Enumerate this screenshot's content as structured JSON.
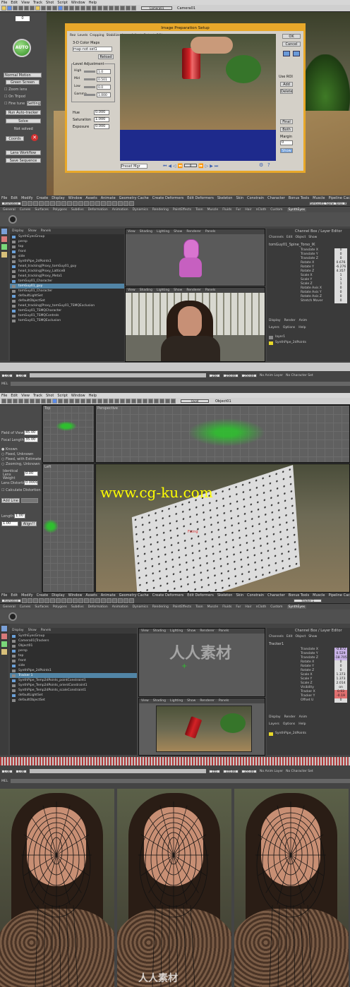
{
  "synth": {
    "menu": [
      "File",
      "Edit",
      "View",
      "Track",
      "Shot",
      "Script",
      "Window",
      "Help"
    ],
    "camera_select": "Camera01",
    "camera_label": "Camera01",
    "counter": "0",
    "auto_label": "AUTO",
    "motion_select": "Normal Motion",
    "green_screen": "Green Screen",
    "zoom_lens": "Zoom lens",
    "on_tripod": "On Tripod",
    "fine_tune": "Fine tune",
    "settings": "Settings",
    "run_auto": "Run Auto-tracker",
    "solve": "Solve",
    "not_solved": "Not solved",
    "coords": "Coords",
    "lens_workflow": "Lens Workflow",
    "save_sequence": "Save Sequence"
  },
  "dialog": {
    "title": "Image Preparation Setup",
    "tabs": [
      "Rez",
      "Levels",
      "Cropping",
      "Stabilize",
      "Lens",
      "Adjust",
      "Output",
      "ROI"
    ],
    "color_mode_label": "3-D Color Maps",
    "color_mode": "map-not-set1",
    "reload": "Reload",
    "group_title": "Level Adjustment",
    "levels": [
      {
        "label": "High",
        "value": "1.0"
      },
      {
        "label": "Mid",
        "value": "0.501"
      },
      {
        "label": "Low",
        "value": "0.0"
      },
      {
        "label": "Gamma",
        "value": "1.000"
      }
    ],
    "hue_label": "Hue",
    "hue": "0.000",
    "sat_label": "Saturation",
    "sat": "1.000",
    "exp_label": "Exposure",
    "exp": "0.000",
    "ok": "OK",
    "cancel": "Cancel",
    "use_roi": "Use ROI",
    "add": "Add",
    "delete": "Delete",
    "final": "Final",
    "both": "Both",
    "margin_label": "Margin",
    "margin": "0",
    "show": "Show",
    "preset": "Preset Mgr",
    "frame": "0"
  },
  "maya1": {
    "menu": [
      "File",
      "Edit",
      "Modify",
      "Create",
      "Display",
      "Window",
      "Assets",
      "Animate",
      "Geometry Cache",
      "Create Deformers",
      "Edit Deformers",
      "Skeleton",
      "Skin",
      "Constrain",
      "Character",
      "Bonus Tools",
      "Muscle",
      "Pipeline Cache",
      "Help"
    ],
    "mode": "Animation",
    "shelf": [
      "General",
      "Curves",
      "Surfaces",
      "Polygons",
      "Subdivs",
      "Deformation",
      "Animation",
      "Dynamics",
      "Rendering",
      "PaintEffects",
      "Toon",
      "Muscle",
      "Fluids",
      "Fur",
      "Hair",
      "nCloth",
      "Custom",
      "SynthEyes"
    ],
    "shelf_active": "SynthEyes",
    "outliner_menu": [
      "Display",
      "Show",
      "Panels"
    ],
    "outliner": [
      "SynthEyesGroup",
      "persp",
      "top",
      "front",
      "side",
      "SynthPipe_2dPoints1",
      "head_tracking|Proxy_tomGuy01_guy",
      "head_tracking|Proxy_LatticeB",
      "head_tracking|Proxy_Meta1",
      "tomGuy01_Character",
      "tomGuy01_guy",
      "tomGuy01_Character",
      "defaultLightSet",
      "defaultObjectSet",
      "head_tracking|Proxy_tomGuy01_TSMQExclusion",
      "tomGuy01_TSMQCharacter",
      "tomGuy01_TSMQControls",
      "tomGuy01_TSMQExclusion"
    ],
    "outliner_sel": 10,
    "vp_menu": [
      "View",
      "Shading",
      "Lighting",
      "Show",
      "Renderer",
      "Panels"
    ],
    "cb_header": [
      "Channels",
      "Edit",
      "Object",
      "Show"
    ],
    "cb_title": "Channel Box / Layer Editor",
    "cb_object": "tomGuy01_Spine_Torso_IK",
    "channels": [
      {
        "n": "Translate X",
        "v": "0"
      },
      {
        "n": "Translate Y",
        "v": "0"
      },
      {
        "n": "Translate Z",
        "v": "0"
      },
      {
        "n": "Rotate X",
        "v": "0.676"
      },
      {
        "n": "Rotate Y",
        "v": "-6.276"
      },
      {
        "n": "Rotate Z",
        "v": "4.357"
      },
      {
        "n": "Scale X",
        "v": "1"
      },
      {
        "n": "Scale Y",
        "v": "1"
      },
      {
        "n": "Scale Z",
        "v": "1"
      },
      {
        "n": "Rotate Axis X",
        "v": "0"
      },
      {
        "n": "Rotate Axis Y",
        "v": "0"
      },
      {
        "n": "Rotate Axis Z",
        "v": "0"
      },
      {
        "n": "Stretch Mover",
        "v": "0"
      }
    ],
    "layer_tabs": [
      "Display",
      "Render",
      "Anim"
    ],
    "layer_menu": [
      "Layers",
      "Options",
      "Help"
    ],
    "layers": [
      "layer1",
      "SynthPipe_2dPoints"
    ],
    "time_start": "1.00",
    "time_end": "1.00",
    "range_a": "250",
    "range_b": "250.00",
    "range_c": "250.00",
    "anim_layer": "No Anim Layer",
    "char_set": "No Character Set",
    "mel": "MEL"
  },
  "synth2": {
    "menu": [
      "File",
      "Edit",
      "View",
      "Track",
      "Shot",
      "Script",
      "Window",
      "Help"
    ],
    "view_select": "Quad",
    "object_label": "Object01",
    "fov_label": "Field of View",
    "fov": "45.00",
    "focal_label": "Focal Length",
    "focal": "35.00",
    "known": "Known",
    "fixed_unknown": "Fixed, Unknown",
    "fixed_hint": "Fixed, with Estimate",
    "zooming": "Zooming, Unknown",
    "lens_weight_label": "Identical Lens Weight",
    "lens_weight": "0.00",
    "lens_dist_label": "Lens Distortion",
    "lens_dist": "0.0000",
    "calc_dist": "Calculate Distortion",
    "add_line": "Add Line",
    "length_label": "Length",
    "length": "1.00",
    "unit_label": "1.00",
    "align": "Align!!",
    "top_label": "Top",
    "perspective_label": "Perspective",
    "left_label": "Left",
    "watermark": "www.cg-ku.com",
    "fixing_label": "Fixing"
  },
  "maya2": {
    "menu": [
      "File",
      "Edit",
      "Modify",
      "Create",
      "Display",
      "Window",
      "Assets",
      "Animate",
      "Geometry Cache",
      "Create Deformers",
      "Edit Deformers",
      "Skeleton",
      "Skin",
      "Constrain",
      "Character",
      "Bonus Tools",
      "Muscle",
      "Pipeline Cache",
      "Help"
    ],
    "mode": "Animation",
    "object": "Tracker 1",
    "shelf": [
      "General",
      "Curves",
      "Surfaces",
      "Polygons",
      "Subdivs",
      "Deformation",
      "Animation",
      "Dynamics",
      "Rendering",
      "PaintEffects",
      "Toon",
      "Muscle",
      "Fluids",
      "Fur",
      "Hair",
      "nCloth",
      "Custom",
      "SynthEyes"
    ],
    "shelf_active": "SynthEyes",
    "outliner_menu": [
      "Display",
      "Show",
      "Panels"
    ],
    "outliner": [
      "SynthEyesGroup",
      "Camera01|Trackers",
      "Object01",
      "persp",
      "top",
      "front",
      "side",
      "SynthPipe_2dPoints1",
      "Tracker 1",
      "SynthPipe_Temp2dPoints_pointConstraint1",
      "SynthPipe_Temp2dPoints_orientConstraint1",
      "SynthPipe_Temp2dPoints_scaleConstraint1",
      "defaultLightSet",
      "defaultObjectSet"
    ],
    "outliner_sel": 8,
    "vp_menu": [
      "View",
      "Shading",
      "Lighting",
      "Show",
      "Renderer",
      "Panels"
    ],
    "cb_header": [
      "Channels",
      "Edit",
      "Object",
      "Show"
    ],
    "cb_title": "Channel Box / Layer Editor",
    "cb_object": "Tracker1",
    "channels": [
      {
        "n": "Translate X",
        "v": "-0.872"
      },
      {
        "n": "Translate Y",
        "v": "0.529"
      },
      {
        "n": "Translate Z",
        "v": "-18.705"
      },
      {
        "n": "Rotate X",
        "v": "0"
      },
      {
        "n": "Rotate Y",
        "v": "0"
      },
      {
        "n": "Rotate Z",
        "v": "0"
      },
      {
        "n": "Scale X",
        "v": "1.373"
      },
      {
        "n": "Scale Y",
        "v": "1.373"
      },
      {
        "n": "Scale Z",
        "v": "2.014"
      },
      {
        "n": "Visibility",
        "v": "on"
      },
      {
        "n": "Tracker X",
        "v": "0.93"
      },
      {
        "n": "Tracker Y",
        "v": "-0.19"
      },
      {
        "n": "Offset U",
        "v": "0"
      }
    ],
    "layer_tabs": [
      "Display",
      "Render",
      "Anim"
    ],
    "layer_menu": [
      "Layers",
      "Options",
      "Help"
    ],
    "layers": [
      "SynthPipe_2dPoints"
    ],
    "time_start": "1.00",
    "time_end": "1.00",
    "range_a": "155",
    "range_b": "155.00",
    "range_c": "155.00",
    "anim_layer": "No Anim Layer",
    "char_set": "No Character Set",
    "mel": "MEL"
  },
  "faces": {
    "watermark": "人人素材"
  },
  "overlay": {
    "watermark": "人人素材"
  },
  "colors": {
    "accent": "#5285a6",
    "green": "#2fbf2f",
    "dialog_border": "#e8a82a",
    "synth_bg": "#4a4a4a"
  }
}
